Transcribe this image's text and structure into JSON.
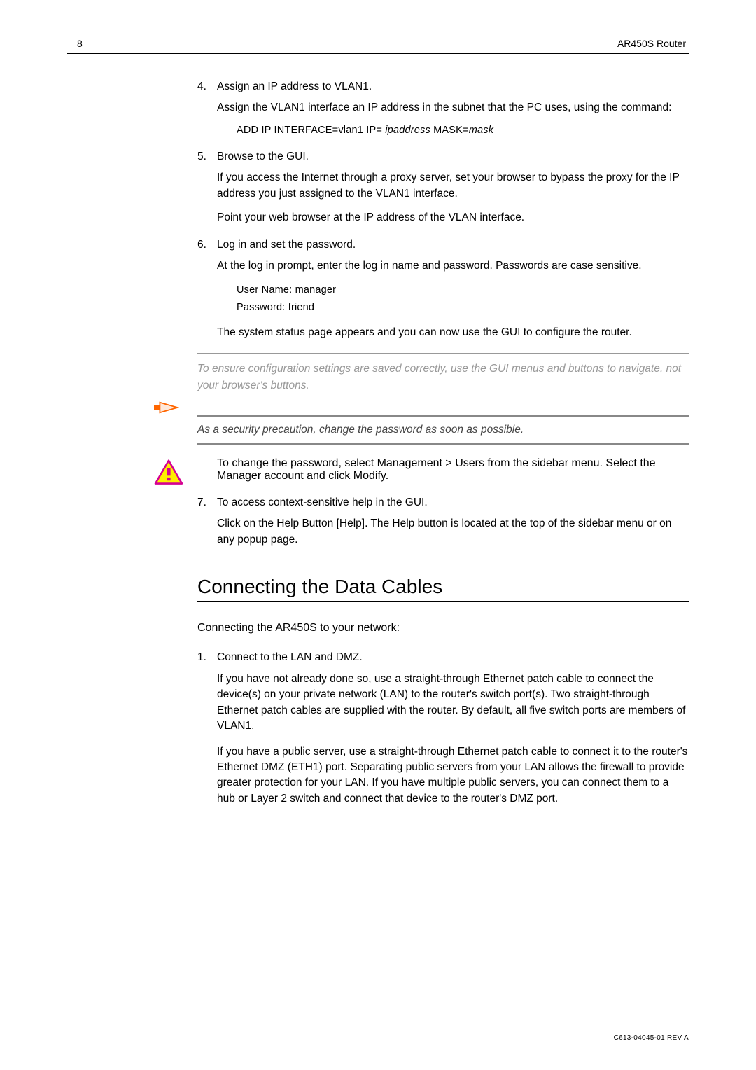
{
  "header": {
    "page_number": "8",
    "doc_title": "AR450S Router"
  },
  "steps_a": [
    {
      "num": "4.",
      "title": "Assign an IP address to VLAN1.",
      "paras": [
        "Assign the VLAN1 interface an IP address in the subnet that the PC uses, using the command:"
      ],
      "cmd_plain": "ADD IP INTERFACE=vlan1 IP=",
      "cmd_italic1": "ipaddress",
      "cmd_mid": " MASK=",
      "cmd_italic2": "mask"
    },
    {
      "num": "5.",
      "title": "Browse to the GUI.",
      "paras": [
        "If you access the Internet through a proxy server, set your browser to bypass the proxy for the IP address you just assigned to the VLAN1 interface.",
        "Point your web browser at the IP address of the VLAN interface."
      ]
    },
    {
      "num": "6.",
      "title": "Log in and set the password.",
      "paras": [
        "At the log in prompt, enter the log in name and password. Passwords are case sensitive."
      ],
      "cred_lines": [
        "User Name:   manager",
        "Password:   friend"
      ],
      "paras_after": [
        "The system status page appears and you can now use the GUI to configure the router."
      ]
    }
  ],
  "note": "To ensure configuration settings are saved correctly, use the GUI menus and buttons to navigate, not your browser's buttons.",
  "caution": "As a security precaution, change the password as soon as possible.",
  "after_caution": [
    "To change the password, select Management > Users from the sidebar menu. Select the Manager account and click Modify."
  ],
  "steps_b": [
    {
      "num": "7.",
      "title": "To access context-sensitive help in the GUI.",
      "paras": [
        "Click on the Help Button [Help]. The Help button is located at the top of the sidebar menu or on any popup page."
      ]
    }
  ],
  "section2": {
    "title": "Connecting the Data Cables",
    "subhead": "Connecting the AR450S to your network:",
    "steps": [
      {
        "num": "1.",
        "title": "Connect to the LAN and DMZ.",
        "paras": [
          "If you have not already done so, use a straight-through Ethernet patch cable to connect the device(s) on your private network (LAN) to the router's switch port(s). Two straight-through Ethernet patch cables are supplied with the router. By default, all five switch ports are members of VLAN1.",
          "If you have a public server, use a straight-through Ethernet patch cable to connect it to the router's Ethernet DMZ (ETH1) port. Separating public servers from your LAN allows the firewall to provide greater protection for your LAN. If you have multiple public servers, you can connect them to a hub or Layer 2 switch and connect that device to the router's DMZ port."
        ]
      }
    ]
  },
  "footer": "C613-04045-01 REV A"
}
